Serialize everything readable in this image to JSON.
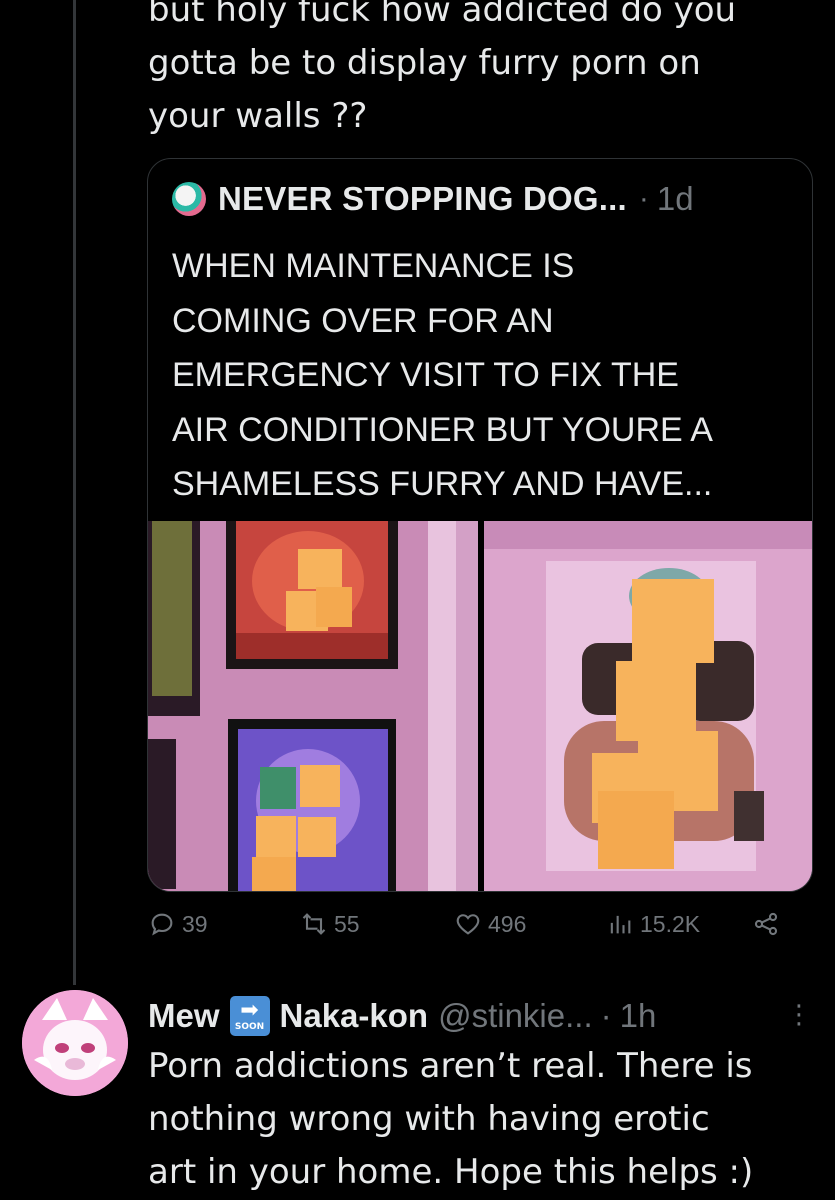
{
  "tweet": {
    "text_lines": [
      "but holy fuck how addicted do you",
      "gotta be to display furry porn on",
      "your walls ??"
    ]
  },
  "quote": {
    "author": "NEVER STOPPING DOG...",
    "separator": "·",
    "time": "1d",
    "text_lines": [
      "WHEN MAINTENANCE IS",
      "COMING OVER FOR AN",
      "EMERGENCY VISIT TO FIX THE",
      "AIR CONDITIONER BUT YOURE A",
      "SHAMELESS FURRY AND HAVE..."
    ]
  },
  "actions": {
    "replies": "39",
    "reposts": "55",
    "likes": "496",
    "views": "15.2K"
  },
  "reply": {
    "name_first": "Mew",
    "emoji_label": "SOON",
    "name_second": "Naka-kon",
    "handle": "@stinkie...",
    "separator": "·",
    "time": "1h",
    "text_lines": [
      "Porn addictions aren’t real. There is",
      "nothing wrong with having erotic",
      "art in your home. Hope this helps :)"
    ]
  },
  "colors": {
    "background": "#000000",
    "text": "#e7e9ea",
    "muted": "#71767b",
    "border": "#2f3336",
    "sticky_note": "#f7b35c"
  },
  "icons": [
    "reply-icon",
    "repost-icon",
    "like-icon",
    "views-icon",
    "share-icon",
    "more-icon",
    "soon-arrow-emoji"
  ]
}
